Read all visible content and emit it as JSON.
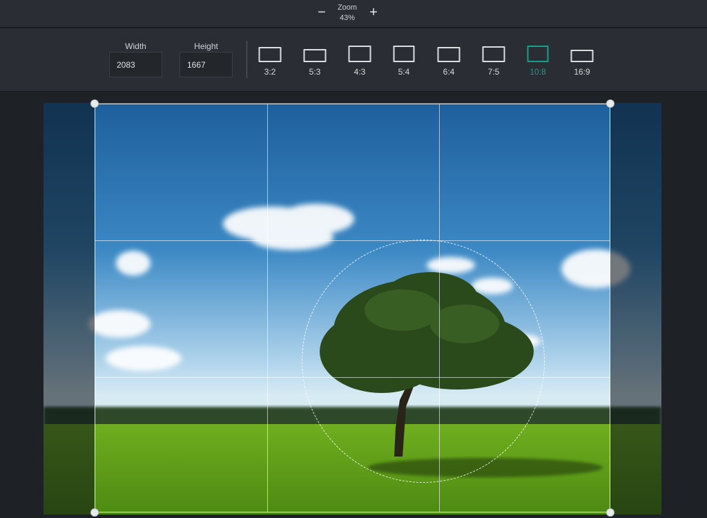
{
  "zoom": {
    "label": "Zoom",
    "value": "43%",
    "minus": "−",
    "plus": "+"
  },
  "dimensions": {
    "width_label": "Width",
    "width_value": "2083",
    "height_label": "Height",
    "height_value": "1667"
  },
  "ratios": [
    {
      "label": "3:2"
    },
    {
      "label": "5:3"
    },
    {
      "label": "4:3"
    },
    {
      "label": "5:4"
    },
    {
      "label": "6:4"
    },
    {
      "label": "7:5"
    },
    {
      "label": "10:8",
      "active": true
    },
    {
      "label": "16:9"
    }
  ],
  "colors": {
    "accent": "#14a189",
    "toolbar_bg": "#2a2e34",
    "canvas_bg": "#1e2226"
  },
  "icons": {
    "zoom_out": "minus-icon",
    "zoom_in": "plus-icon"
  }
}
